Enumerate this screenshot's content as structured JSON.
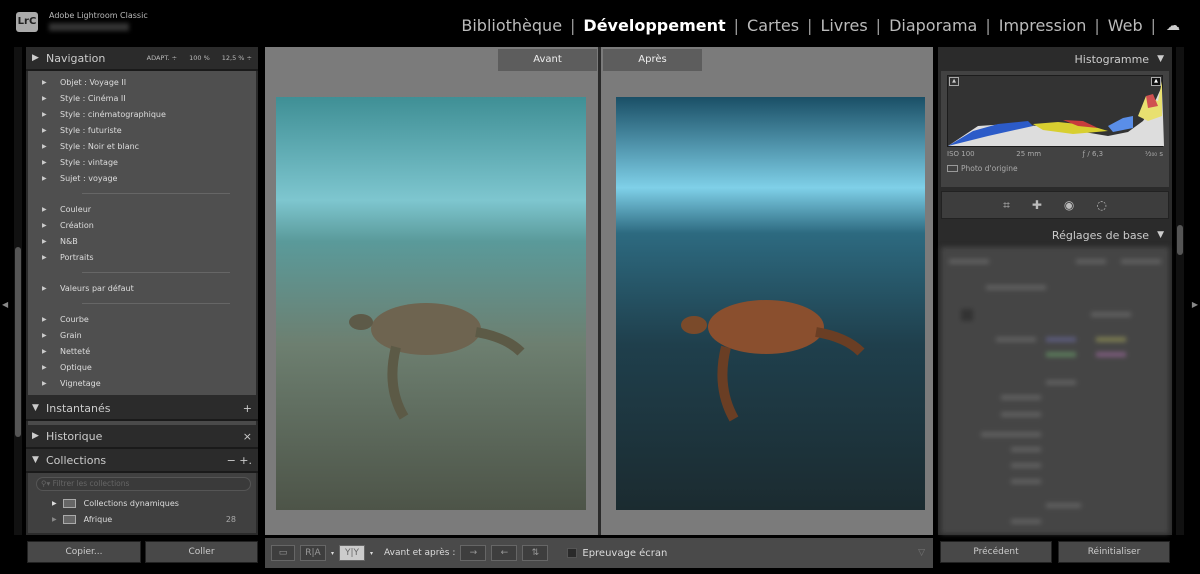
{
  "app": {
    "logo": "LrC",
    "name": "Adobe Lightroom Classic"
  },
  "modules": [
    {
      "label": "Bibliothèque"
    },
    {
      "label": "Développement",
      "active": true
    },
    {
      "label": "Cartes"
    },
    {
      "label": "Livres"
    },
    {
      "label": "Diaporama"
    },
    {
      "label": "Impression"
    },
    {
      "label": "Web"
    }
  ],
  "cloud_icon": "☁",
  "left": {
    "navigation": {
      "title": "Navigation",
      "opts": [
        "ADAPT. ÷",
        "100 %",
        "12,5 % ÷"
      ]
    },
    "preset_groups": [
      [
        "Objet : Voyage II",
        "Style : Cinéma II",
        "Style : cinématographique",
        "Style : futuriste",
        "Style : Noir et blanc",
        "Style : vintage",
        "Sujet : voyage"
      ],
      [
        "Couleur",
        "Création",
        "N&B",
        "Portraits"
      ],
      [
        "Valeurs par défaut"
      ],
      [
        "Courbe",
        "Grain",
        "Netteté",
        "Optique",
        "Vignetage"
      ]
    ],
    "snapshots": {
      "title": "Instantanés",
      "action": "+"
    },
    "history": {
      "title": "Historique",
      "action": "×"
    },
    "collections": {
      "title": "Collections",
      "actions": "− +.",
      "filter_placeholder": "Filtrer les collections",
      "items": [
        {
          "label": "Collections dynamiques",
          "count": ""
        },
        {
          "label": "Afrique",
          "count": "28"
        }
      ]
    },
    "copy": "Copier...",
    "paste": "Coller"
  },
  "center": {
    "before": "Avant",
    "after": "Après"
  },
  "toolbar": {
    "view_loupe": "",
    "view_ra": "R|A",
    "view_yy": "Y|Y",
    "before_after_label": "Avant et après :",
    "soft_proof": "Epreuvage écran",
    "soft_proof_checked": false
  },
  "right": {
    "histogram": {
      "title": "Histogramme",
      "iso": "ISO 100",
      "focal": "25 mm",
      "aperture": "ƒ / 6,3",
      "shutter": "¹⁄₂₀₀ s",
      "original": "Photo d'origine"
    },
    "tools": [
      "crop-icon",
      "healing-icon",
      "red-eye-icon",
      "mask-icon"
    ],
    "basic": {
      "title": "Réglages de base"
    },
    "previous": "Précédent",
    "reset": "Réinitialiser"
  },
  "colors": {
    "accent_active": "#ffffff",
    "panel": "#2b2b2b",
    "center_bg": "#7b7b7b"
  }
}
